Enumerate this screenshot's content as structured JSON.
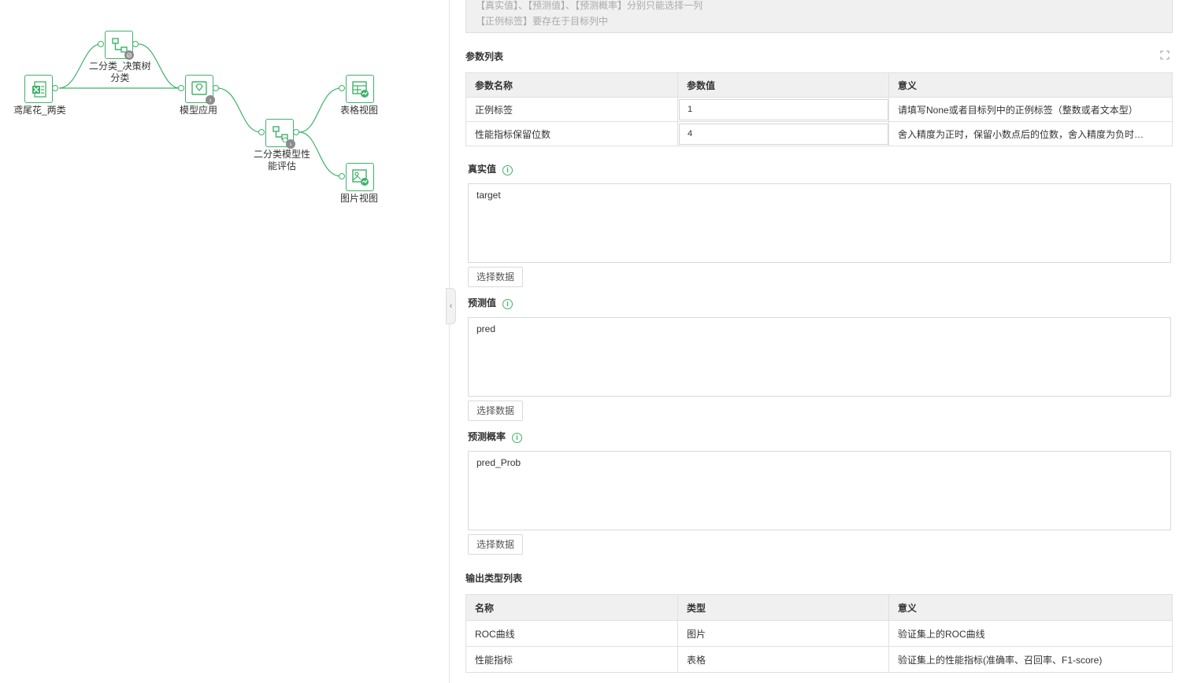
{
  "canvas": {
    "nodes": {
      "iris": "鸢尾花_两类",
      "dtree_line1": "二分类_决策树",
      "dtree_line2": "分类",
      "apply": "模型应用",
      "eval_line1": "二分类模型性",
      "eval_line2": "能评估",
      "table_view": "表格视图",
      "image_view": "图片视图"
    },
    "icons": {
      "iris": "excel-icon",
      "dtree": "tree-icon",
      "apply": "model-icon",
      "eval": "tree-eval-icon",
      "table_view": "table-chart-icon",
      "image_view": "image-chart-icon"
    },
    "accent_color": "#3fb26a"
  },
  "panel": {
    "notice": {
      "line1": "【真实值】、【预测值】、【预测概率】分别只能选择一列",
      "line2": "【正例标签】要存在于目标列中"
    },
    "params": {
      "title": "参数列表",
      "headers": [
        "参数名称",
        "参数值",
        "意义"
      ],
      "rows": [
        {
          "name": "正例标签",
          "value": "1",
          "meaning": "请填写None或者目标列中的正例标签（整数或者文本型）"
        },
        {
          "name": "性能指标保留位数",
          "value": "4",
          "meaning": "舍入精度为正时，保留小数点后的位数，舍入精度为负时…"
        }
      ]
    },
    "true_value": {
      "title": "真实值",
      "value": "target",
      "button": "选择数据"
    },
    "pred_value": {
      "title": "预测值",
      "value": "pred",
      "button": "选择数据"
    },
    "pred_prob": {
      "title": "预测概率",
      "value": "pred_Prob",
      "button": "选择数据"
    },
    "outputs": {
      "title": "输出类型列表",
      "headers": [
        "名称",
        "类型",
        "意义"
      ],
      "rows": [
        {
          "name": "ROC曲线",
          "type": "图片",
          "meaning": "验证集上的ROC曲线"
        },
        {
          "name": "性能指标",
          "type": "表格",
          "meaning": "验证集上的性能指标(准确率、召回率、F1-score)"
        }
      ]
    }
  }
}
